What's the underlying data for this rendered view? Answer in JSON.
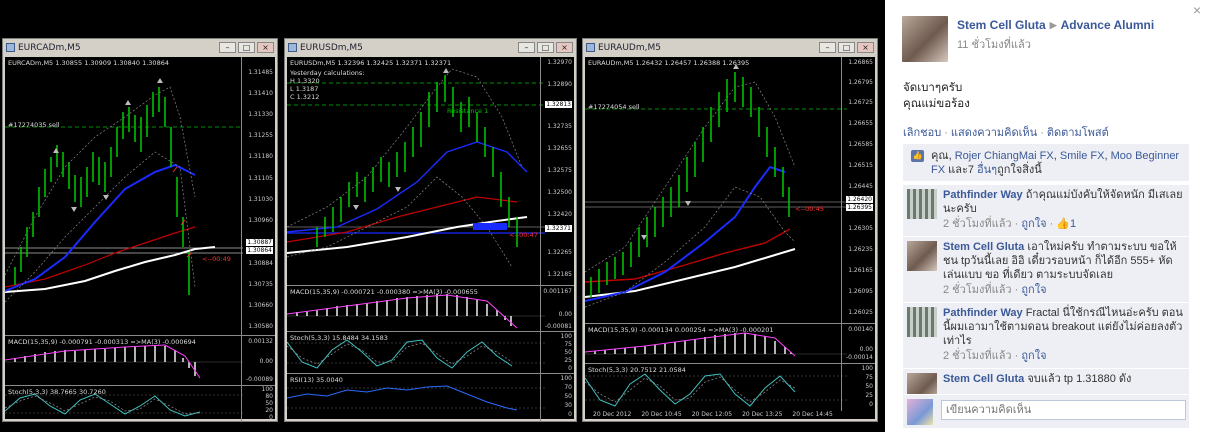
{
  "colors": {
    "chart_bg": "#000000",
    "candle": "#00c000",
    "sig_red": "#ff3030",
    "ma_blue": "#1a2bff",
    "ma_red": "#c00000",
    "fb_link": "#3b5998",
    "fb_bg": "#edeff4"
  },
  "windows": [
    {
      "title": "EURCADm,M5",
      "header": "EURCADm,M5  1.30855 1.30909 1.30840 1.30864",
      "order_label": "#17274035 sell",
      "timer": "<--00:49",
      "price_ticks": [
        "1.31485",
        "1.31410",
        "1.31330",
        "1.31255",
        "1.31180",
        "1.31105",
        "1.31030",
        "1.30960",
        "1.30884",
        "1.30810",
        "1.30735",
        "1.30660",
        "1.30580"
      ],
      "price_highlight": [
        "1.30887",
        "1.30864"
      ],
      "macd_label": "MACD(15,35,9) -0.000791  -0.000313  =>MA(3) -0.000694",
      "macd_ticks": [
        "0.00132",
        "0.00",
        "-0.00089"
      ],
      "stoch_label": "Stoch(5,3,3) 38.7665 30.7260",
      "stoch_ticks": [
        "100",
        "80",
        "50",
        "20",
        "0"
      ]
    },
    {
      "title": "EURUSDm,M5",
      "header": "EURUSDm,M5  1.32396 1.32425 1.32371 1.32371",
      "fib_title": "Yesterday calculations:",
      "fib_levels": [
        "H 1.3320",
        "L 1.3187",
        "C 1.3212"
      ],
      "fib_label_green": "Resistance 1",
      "timer": "<--00:47",
      "price_ticks": [
        "1.32970",
        "1.32890",
        "1.32815",
        "1.32735",
        "1.32655",
        "1.32575",
        "1.32500",
        "1.32420",
        "1.32340",
        "1.32265",
        "1.32185"
      ],
      "price_highlight": [
        "1.32813",
        "1.32371"
      ],
      "macd_label": "MACD(15,35,9) -0.000721  -0.000380  =>MA(3) -0.000655",
      "macd_ticks": [
        "0.001167",
        "0.00",
        "-0.00081"
      ],
      "stoch_label": "Stoch(5,3,3) 15.8484 34.1583",
      "stoch_ticks": [
        "100",
        "75",
        "50",
        "25",
        "0"
      ],
      "rsi_label": "RSI(13) 35.0040",
      "rsi_ticks": [
        "100",
        "70",
        "50",
        "30",
        "0"
      ]
    },
    {
      "title": "EURAUDm,M5",
      "header": "EURAUDm,M5  1.26432 1.26457 1.26388 1.26395",
      "order_label": "#17274054 sell",
      "timer": "<--00:45",
      "price_ticks": [
        "1.26865",
        "1.26795",
        "1.26725",
        "1.26655",
        "1.26585",
        "1.26515",
        "1.26445",
        "1.26375",
        "1.26305",
        "1.26235",
        "1.26165",
        "1.26095",
        "1.26025"
      ],
      "price_highlight": [
        "1.26420",
        "1.26395"
      ],
      "macd_label": "MACD(15,35,9) -0.000134  0.000254  =>MA(3) -0.000201",
      "macd_ticks": [
        "0.00140",
        "0.00",
        "-0.00014"
      ],
      "stoch_label": "Stoch(5,3,3) 20.7512 21.0584",
      "stoch_ticks": [
        "100",
        "75",
        "50",
        "25",
        "0"
      ],
      "x_ticks": [
        "20 Dec 2012",
        "20 Dec 10:45",
        "20 Dec 12:05",
        "20 Dec 13:25",
        "20 Dec 14:45"
      ]
    }
  ],
  "facebook": {
    "close": "×",
    "author": "Stem Cell Gluta",
    "arrow": "▶",
    "group": "Advance Alumni",
    "time": "11 ชั่วโมงที่แล้ว",
    "body_lines": [
      "จัดเบาๆครับ",
      "คุณแม่ขอร้อง"
    ],
    "actions": [
      "เลิกชอบ",
      "แสดงความคิดเห็น",
      "ติดตามโพสต์"
    ],
    "likes": {
      "prefix": "คุณ, ",
      "names": [
        "Rojer ChiangMai FX",
        "Smile FX",
        "Moo Beginner FX"
      ],
      "suffix_and": " และ7 ",
      "others_link": "อื่นๆ",
      "suffix": "ถูกใจสิ่งนี้",
      "sep": ", "
    },
    "comments": [
      {
        "name": "Pathfinder Way",
        "text": " ถ้าคุณแม่บังคับให้จัดหนัก มีเสเลยนะครับ",
        "time": "2 ชั่วโมงที่แล้ว",
        "like": "ถูกใจ",
        "count": "1",
        "avatar": "pw"
      },
      {
        "name": "Stem Cell Gluta",
        "text": " เอาใหม่ครับ ทำตามระบบ ขอให้ชน tpวันนี้เลย อิอิ เดี๋ยวรอบหน้า ก็ได้อีก 555+ หัดเล่นแบบ ขอ ที่เดียว ตามระบบจัดเลย",
        "time": "2 ชั่วโมงที่แล้ว",
        "like": "ถูกใจ",
        "count": "",
        "avatar": "sc"
      },
      {
        "name": "Pathfinder Way",
        "text": " Fractal นี่ใช้กรณีไหนอ่ะครับ ตอนนี้ผมเอามาใช้ตามดอน breakout แต่ยังไม่ค่อยลงตัวเท่าไร",
        "time": "2 ชั่วโมงที่แล้ว",
        "like": "ถูกใจ",
        "count": "",
        "avatar": "pw"
      },
      {
        "name": "Stem Cell Gluta",
        "text": " จบแล้ว tp 1.31880 ดัง",
        "time": "",
        "like": "",
        "count": "",
        "avatar": "sc"
      }
    ],
    "composer_placeholder": "เขียนความคิดเห็น"
  }
}
